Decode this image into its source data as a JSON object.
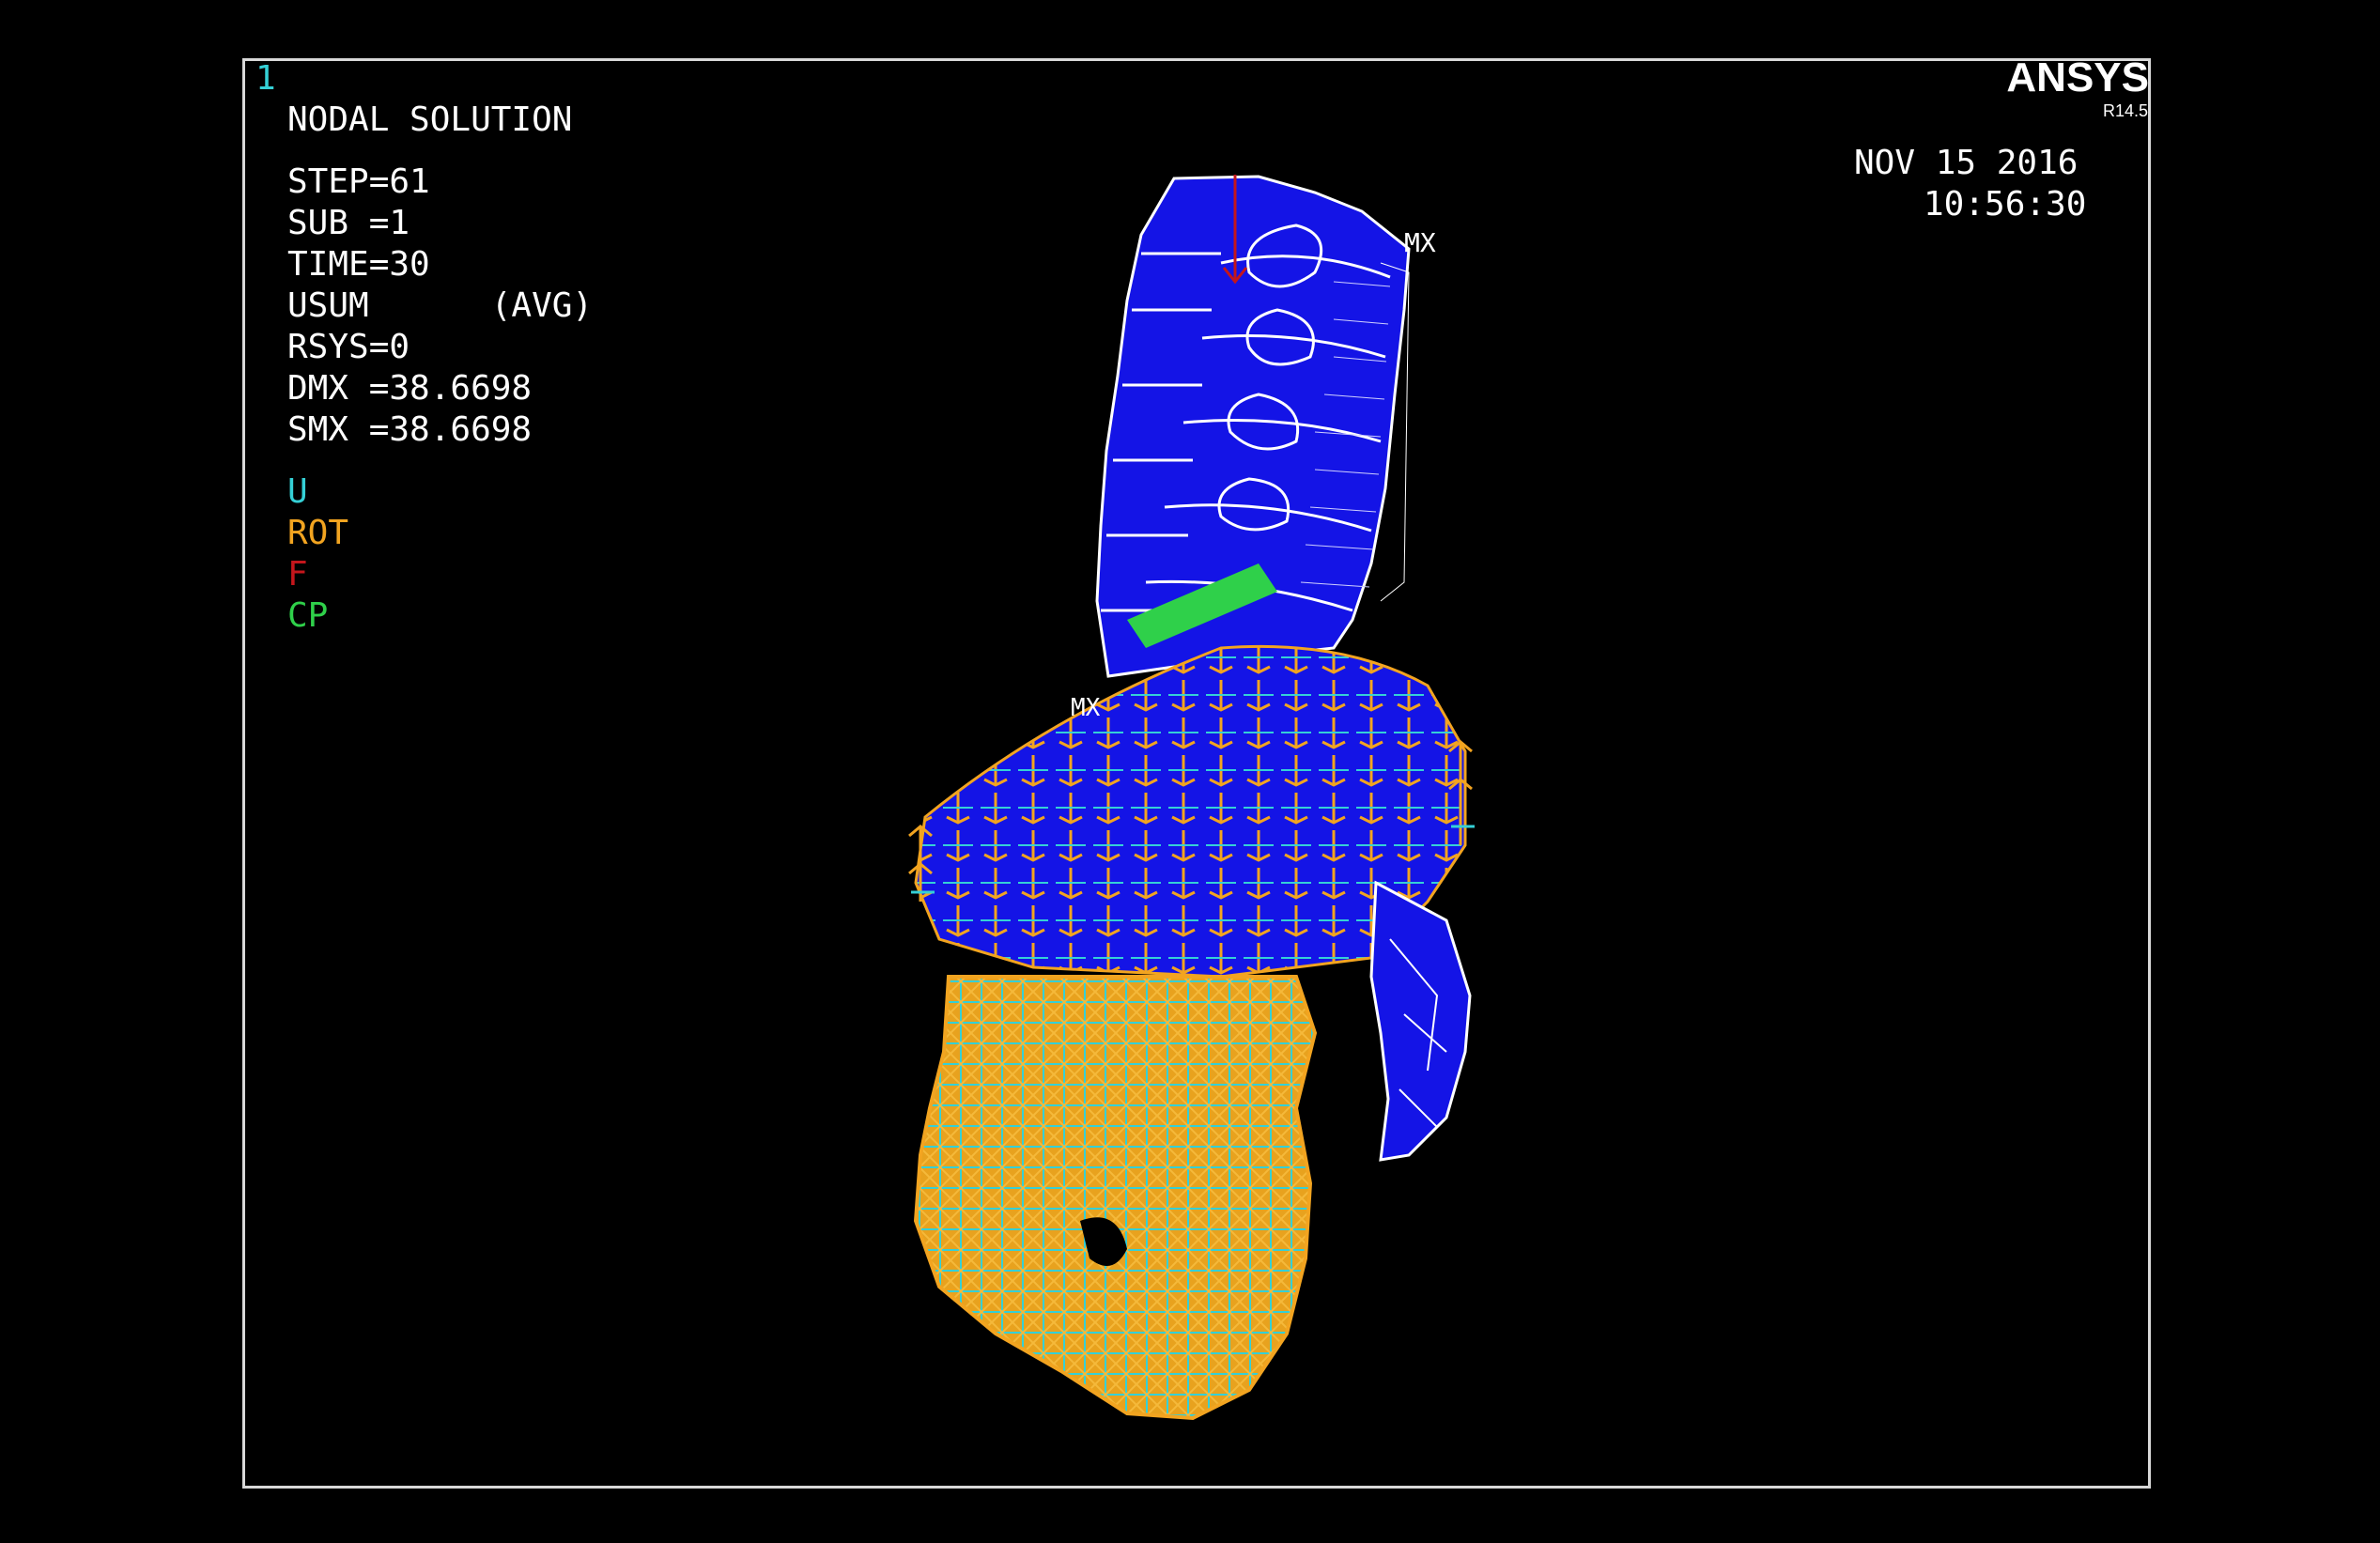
{
  "window_number": "1",
  "header": {
    "title": "NODAL SOLUTION",
    "lines": [
      "STEP=61",
      "SUB =1",
      "TIME=30",
      "USUM      (AVG)",
      "RSYS=0",
      "DMX =38.6698",
      "SMX =38.6698"
    ]
  },
  "legend": [
    {
      "label": "U",
      "color": "#35d0d6"
    },
    {
      "label": "ROT",
      "color": "#f2a420"
    },
    {
      "label": "F",
      "color": "#c4161c"
    },
    {
      "label": "CP",
      "color": "#2fd04a"
    }
  ],
  "brand": {
    "name": "ANSYS",
    "version": "R14.5"
  },
  "datetime": {
    "date": "NOV 15 2016",
    "time": "10:56:30"
  },
  "model_markers": {
    "max_label": "MX",
    "lower_label": "MX"
  },
  "colors": {
    "background": "#000000",
    "frame": "#d8d8d8",
    "spine": "#1414e6",
    "mesh": "#ffffff",
    "rot": "#f2a420",
    "u": "#35d0d6",
    "force": "#c4161c",
    "cp": "#2fd04a"
  }
}
